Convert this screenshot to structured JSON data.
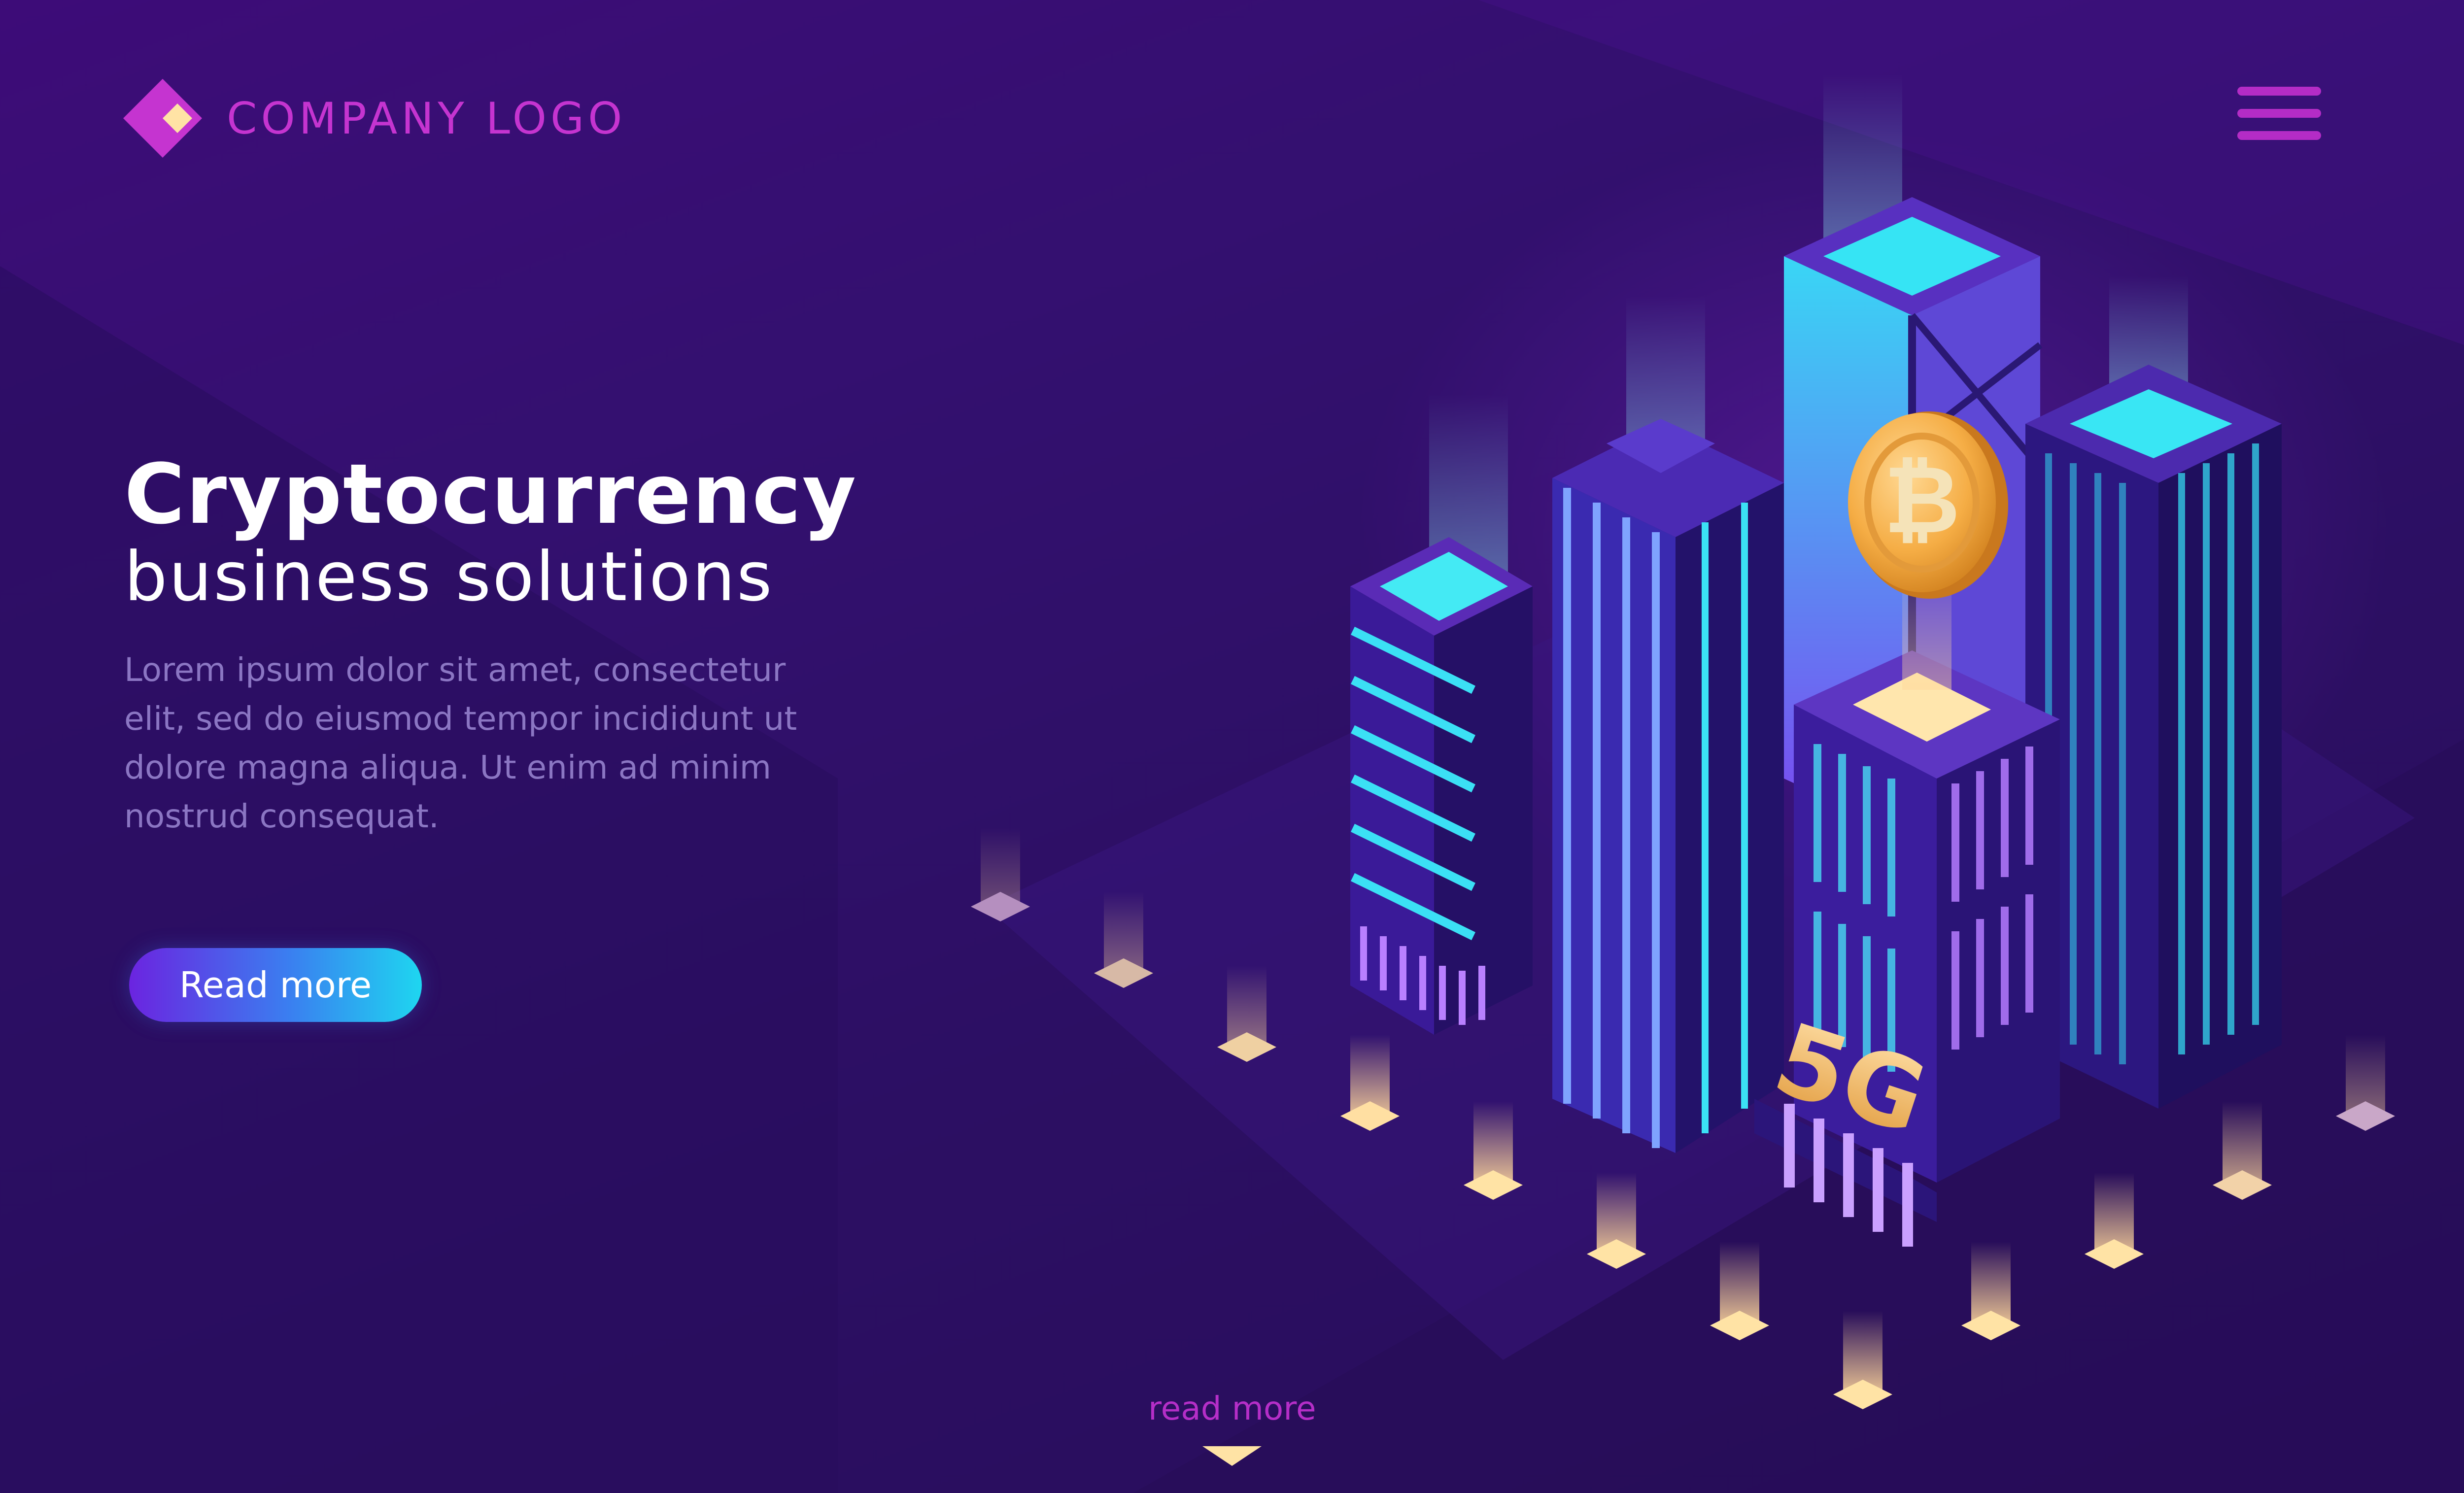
{
  "header": {
    "logo_text": "COMPANY LOGO",
    "menu_icon": "hamburger-menu-icon"
  },
  "hero": {
    "title": "Cryptocurrency",
    "subtitle": "business solutions",
    "body": "Lorem ipsum dolor sit amet, consectetur elit, sed do eiusmod tempor incididunt ut dolore magna aliqua. Ut enim ad minim nostrud consequat.",
    "button_label": "Read more"
  },
  "footer": {
    "read_more_label": "read more",
    "arrow_icon": "chevron-down-icon"
  },
  "illustration": {
    "coin_icon": "bitcoin-icon",
    "tower_sign": "5G"
  },
  "colors": {
    "background": "#2e0e66",
    "accent_magenta": "#c534d0",
    "accent_cyan": "#1ed6f0",
    "accent_gold": "#f5b24a",
    "body_text": "#8b76c3"
  }
}
